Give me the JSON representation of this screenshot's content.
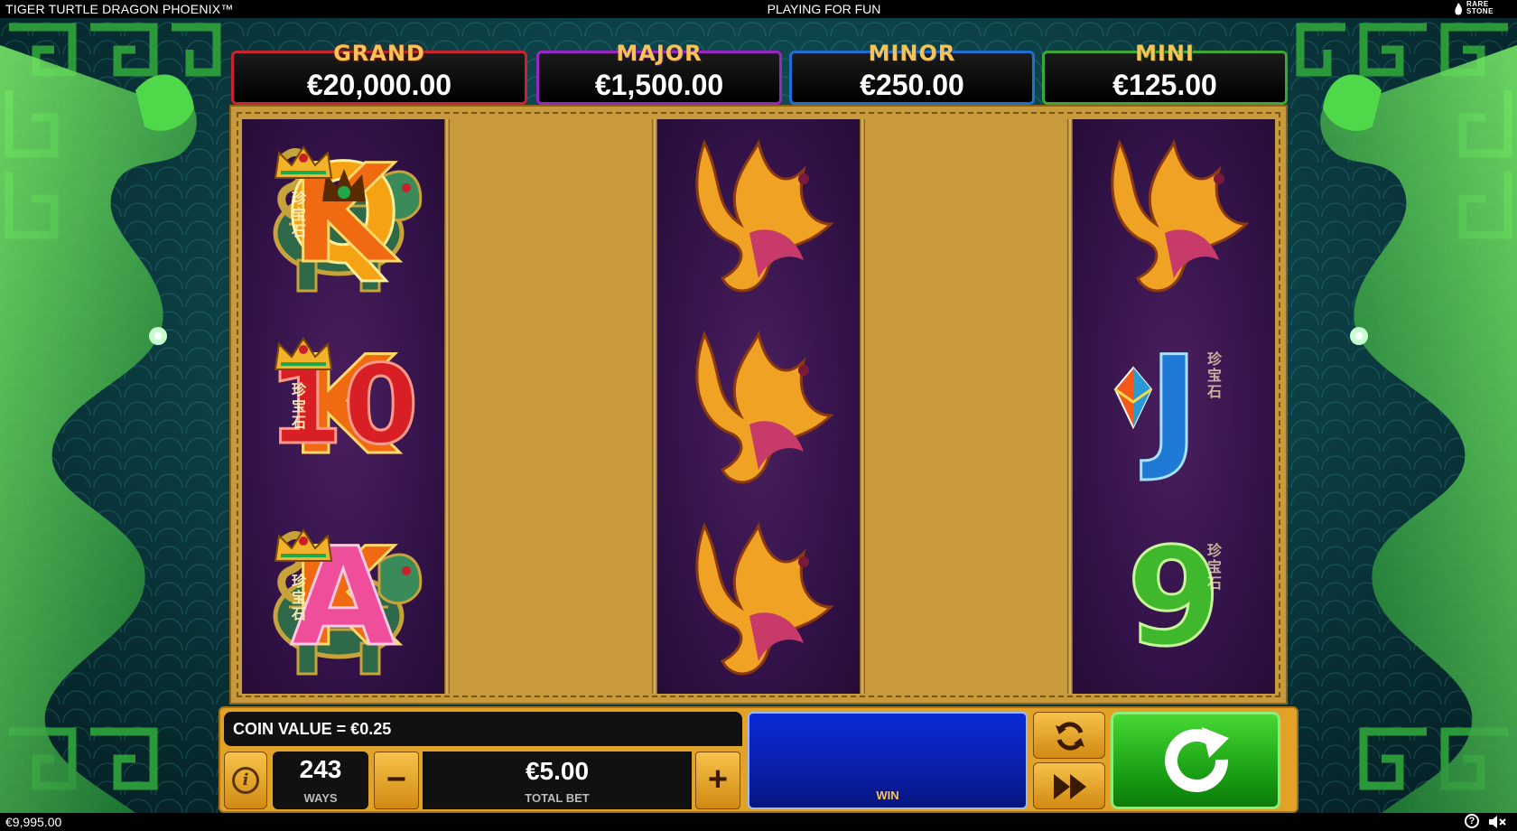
{
  "header": {
    "game_title": "TIGER TURTLE DRAGON PHOENIX™",
    "mode": "PLAYING FOR FUN",
    "brand": "RARE STONE"
  },
  "jackpots": [
    {
      "label": "GRAND",
      "amount": "€20,000.00",
      "color": "#c8242f"
    },
    {
      "label": "MAJOR",
      "amount": "€1,500.00",
      "color": "#9a27c4"
    },
    {
      "label": "MINOR",
      "amount": "€250.00",
      "color": "#1f6fd0"
    },
    {
      "label": "MINI",
      "amount": "€125.00",
      "color": "#3fa533"
    }
  ],
  "reels": [
    [
      "Q",
      "K",
      "K"
    ],
    [
      "phoenix",
      "phoenix",
      "phoenix"
    ],
    [
      "phoenix",
      "J",
      "9"
    ],
    [
      "K",
      "K",
      "A"
    ],
    [
      "turtle",
      "10",
      "turtle"
    ]
  ],
  "symbol_characters": "珍宝石",
  "controls": {
    "coin_value": "COIN VALUE = €0.25",
    "ways_value": "243",
    "ways_label": "WAYS",
    "total_bet_value": "€5.00",
    "total_bet_label": "TOTAL BET",
    "minus": "−",
    "plus": "+",
    "win_label": "WIN",
    "info_icon": "info-icon",
    "autoplay_icon": "autoplay-icon",
    "turbo_icon": "fast-forward-icon",
    "spin_icon": "spin-icon"
  },
  "footer": {
    "balance": "€9,995.00",
    "help_icon": "help-icon",
    "sound_icon": "speaker-icon"
  }
}
